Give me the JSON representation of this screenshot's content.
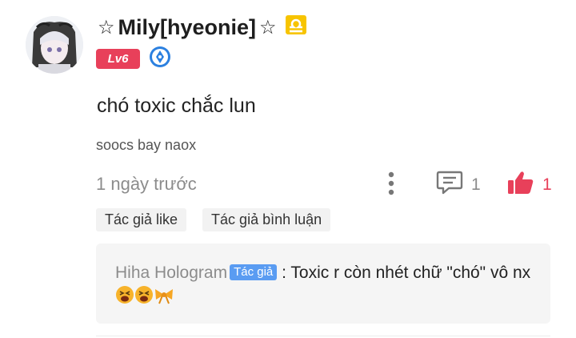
{
  "user": {
    "star_left": "☆",
    "name": "Mily[hyeonie]",
    "star_right": "☆",
    "level": "Lv6"
  },
  "post": {
    "title": "chó toxic chắc lun",
    "body": "soocs bay naox",
    "timestamp": "1 ngày trước",
    "comment_count": "1",
    "like_count": "1"
  },
  "tags": [
    "Tác giả like",
    "Tác giả bình luận"
  ],
  "reply": {
    "author": "Hiha Hologram",
    "author_badge": "Tác giả",
    "separator": " : ",
    "text": "Toxic r còn nhét chữ \"chó\" vô nx"
  },
  "colors": {
    "accent_red": "#e8405a",
    "libra_gold": "#f0b400",
    "badge_blue": "#5a9cf2",
    "muted_gray": "#8c8c8c"
  },
  "icons": [
    "avatar",
    "libra-icon",
    "pen-badge-icon",
    "more-vertical-icon",
    "comment-icon",
    "thumbs-up-icon",
    "tired-face-emoji",
    "bow-emoji"
  ]
}
